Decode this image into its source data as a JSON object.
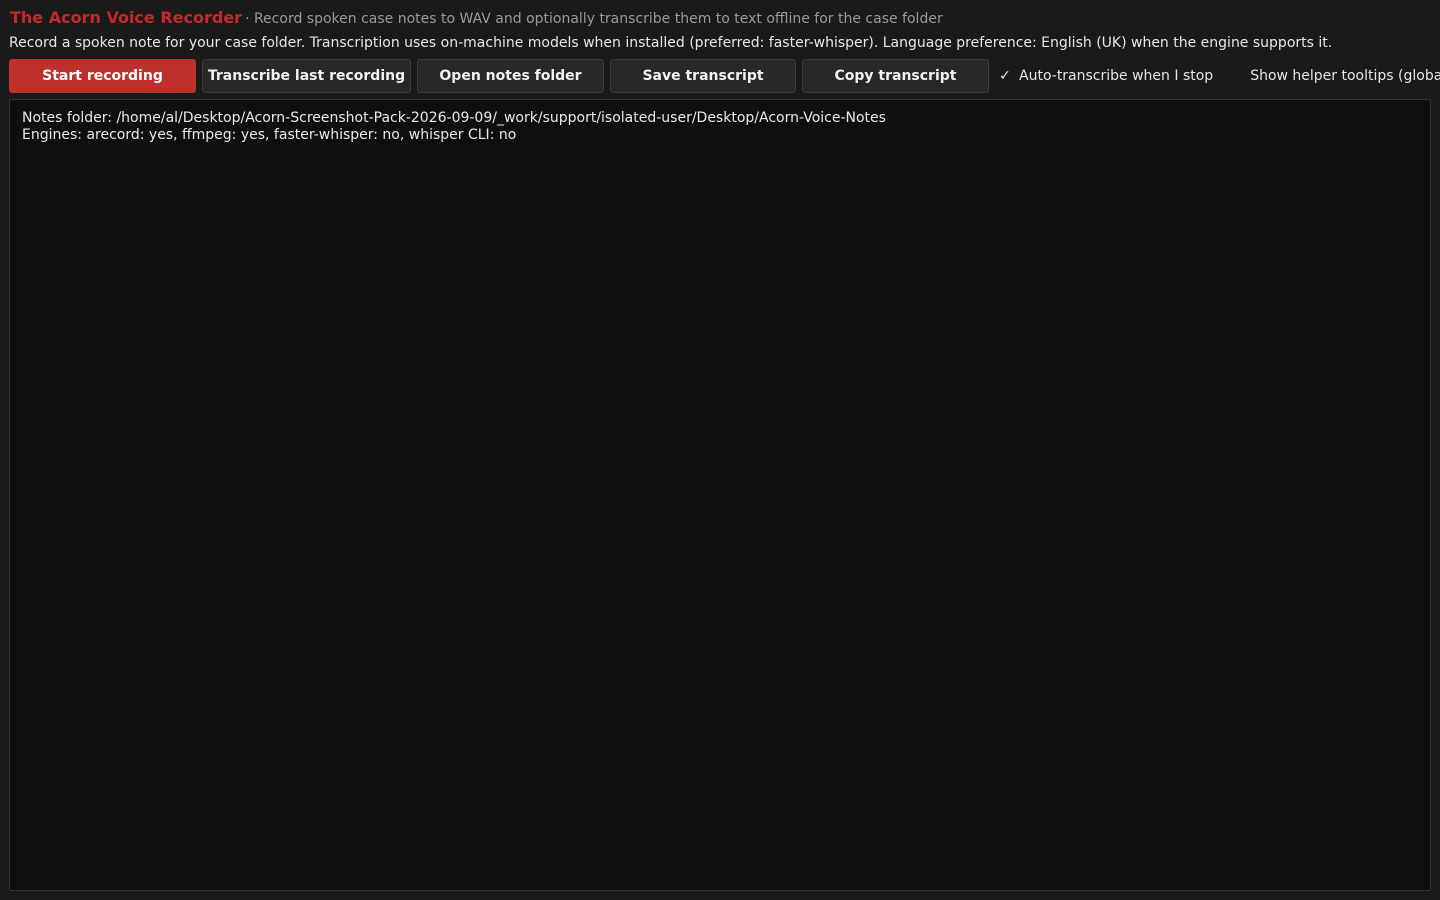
{
  "header": {
    "title": "The Acorn Voice Recorder",
    "subtitle": "· Record spoken case notes to WAV and optionally transcribe them to text offline for the case folder",
    "description": "Record a spoken note for your case folder. Transcription uses on-machine models when installed (preferred: faster-whisper). Language preference: English (UK) when the engine supports it."
  },
  "toolbar": {
    "start_recording": "Start recording",
    "transcribe_last": "Transcribe last recording",
    "open_notes_folder": "Open notes folder",
    "save_transcript": "Save transcript",
    "copy_transcript": "Copy transcript",
    "auto_transcribe": {
      "label": "Auto-transcribe when I stop",
      "checked": true,
      "mark": "✓"
    },
    "helper_tooltips": {
      "label": "Show helper tooltips (global)",
      "checked": false,
      "mark": ""
    }
  },
  "log": {
    "lines": [
      "Notes folder: /home/al/Desktop/Acorn-Screenshot-Pack-2026-09-09/_work/support/isolated-user/Desktop/Acorn-Voice-Notes",
      "Engines: arecord: yes, ffmpeg: yes, faster-whisper: no, whisper CLI: no"
    ]
  },
  "colors": {
    "accent": "#c0302a",
    "title": "#c62828",
    "background": "#1a1a1a",
    "panel": "#0f0f0f"
  }
}
